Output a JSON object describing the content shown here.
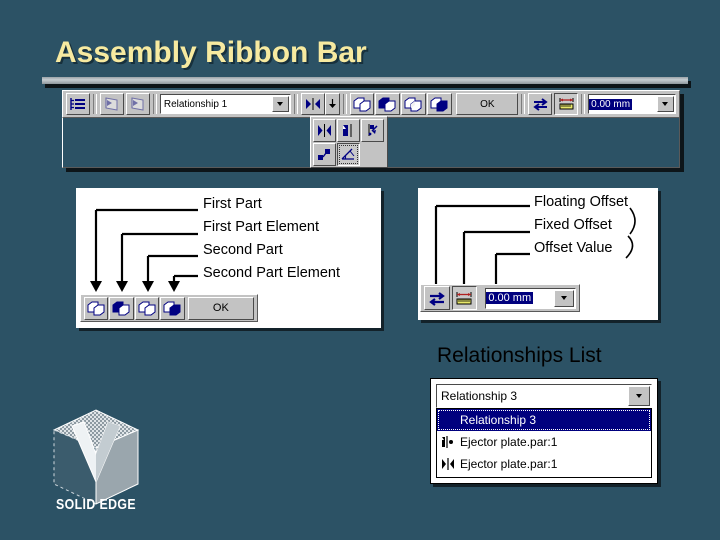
{
  "slide": {
    "title": "Assembly Ribbon Bar",
    "background_color": "#2c5265",
    "title_color": "#f7eaa0"
  },
  "ribbon": {
    "relationship_combo": {
      "value": "Relationship 1"
    },
    "offset_field": {
      "value": "0.00 mm",
      "selected": true
    },
    "ok_button": {
      "label": "OK"
    },
    "buttons": [
      {
        "name": "relationships-list-icon",
        "state": "enabled"
      },
      {
        "name": "flip-plane-icon",
        "state": "disabled"
      },
      {
        "name": "flip-plane-alt-icon",
        "state": "disabled"
      },
      {
        "name": "mate-icon",
        "state": "enabled"
      },
      {
        "name": "dropdown-arrow-icon",
        "state": "enabled"
      },
      {
        "name": "first-part-icon",
        "state": "enabled"
      },
      {
        "name": "first-part-element-icon",
        "state": "enabled"
      },
      {
        "name": "second-part-icon",
        "state": "enabled"
      },
      {
        "name": "second-part-element-icon",
        "state": "enabled"
      },
      {
        "name": "floating-offset-icon",
        "state": "enabled"
      },
      {
        "name": "fixed-offset-icon",
        "state": "pressed"
      }
    ],
    "flyout_buttons": [
      {
        "name": "mate-flyout-icon"
      },
      {
        "name": "planar-align-icon"
      },
      {
        "name": "axial-align-icon"
      },
      {
        "name": "connect-icon"
      },
      {
        "name": "angle-icon",
        "state": "selected"
      }
    ]
  },
  "callout_left": {
    "labels": [
      "First Part",
      "First Part Element",
      "Second Part",
      "Second Part Element"
    ],
    "ok_button": {
      "label": "OK"
    }
  },
  "callout_right": {
    "labels": [
      "Floating Offset",
      "Fixed Offset",
      "Offset Value"
    ],
    "offset_field": {
      "value": "0.00 mm",
      "selected": true
    }
  },
  "relationships_list": {
    "title": "Relationships List",
    "combo_value": "Relationship 3",
    "items": [
      {
        "label": "Relationship 3",
        "selected": true,
        "icon": "none"
      },
      {
        "label": "Ejector plate.par:1",
        "selected": false,
        "icon": "planar-align-icon"
      },
      {
        "label": "Ejector plate.par:1",
        "selected": false,
        "icon": "mate-icon"
      }
    ]
  },
  "logo": {
    "text": "SOLID EDGE"
  }
}
